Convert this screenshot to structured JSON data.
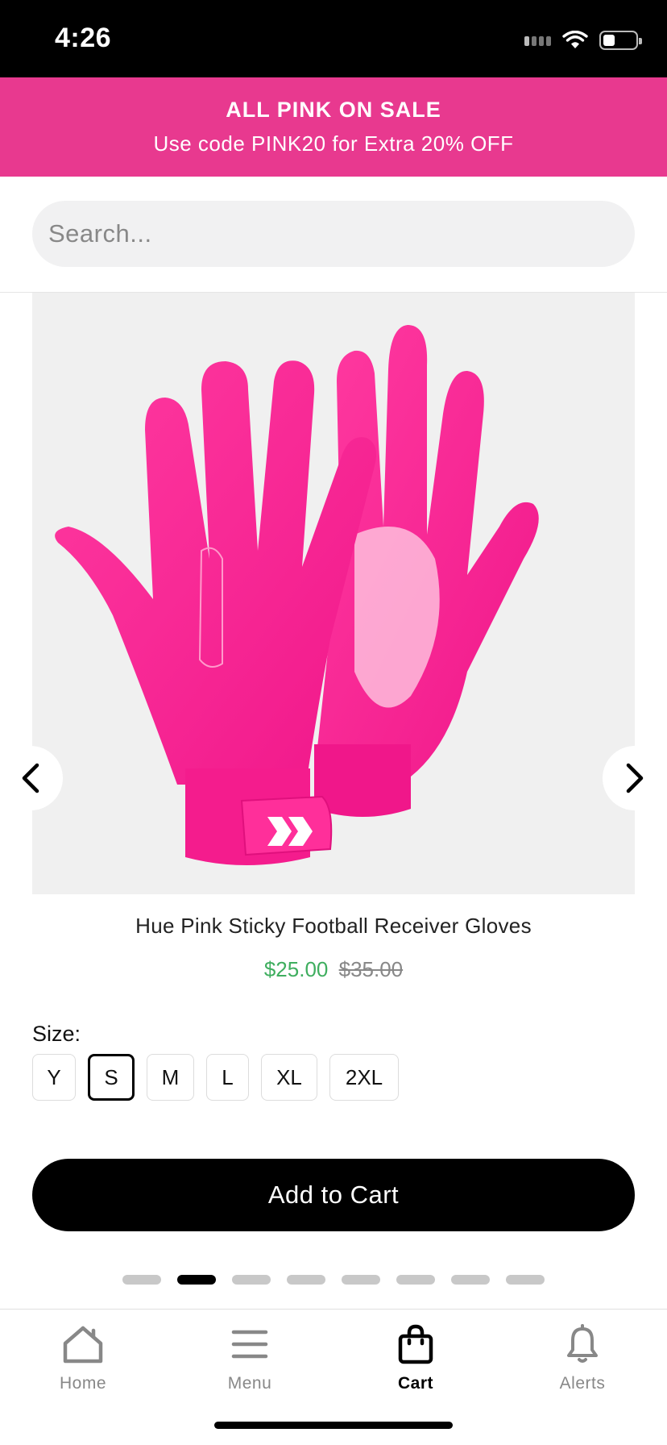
{
  "status_bar": {
    "time": "4:26"
  },
  "promo": {
    "title": "ALL PINK ON SALE",
    "subtitle": "Use code PINK20 for Extra 20% OFF",
    "background": "#e8398f"
  },
  "search": {
    "placeholder": "Search..."
  },
  "product": {
    "title": "Hue Pink Sticky Football Receiver Gloves",
    "sale_price": "$25.00",
    "original_price": "$35.00",
    "image_description_icon": "pink-gloves-image",
    "size_label": "Size:",
    "sizes": [
      "Y",
      "S",
      "M",
      "L",
      "XL",
      "2XL"
    ],
    "selected_size": "S",
    "add_to_cart_label": "Add to Cart"
  },
  "carousel": {
    "page_count": 8,
    "active_index": 1
  },
  "tabs": [
    {
      "label": "Home",
      "icon": "home-icon",
      "active": false
    },
    {
      "label": "Menu",
      "icon": "menu-icon",
      "active": false
    },
    {
      "label": "Cart",
      "icon": "cart-icon",
      "active": true
    },
    {
      "label": "Alerts",
      "icon": "bell-icon",
      "active": false
    }
  ],
  "colors": {
    "accent": "#e8398f",
    "sale_price": "#3fae5f",
    "primary": "#000000"
  }
}
